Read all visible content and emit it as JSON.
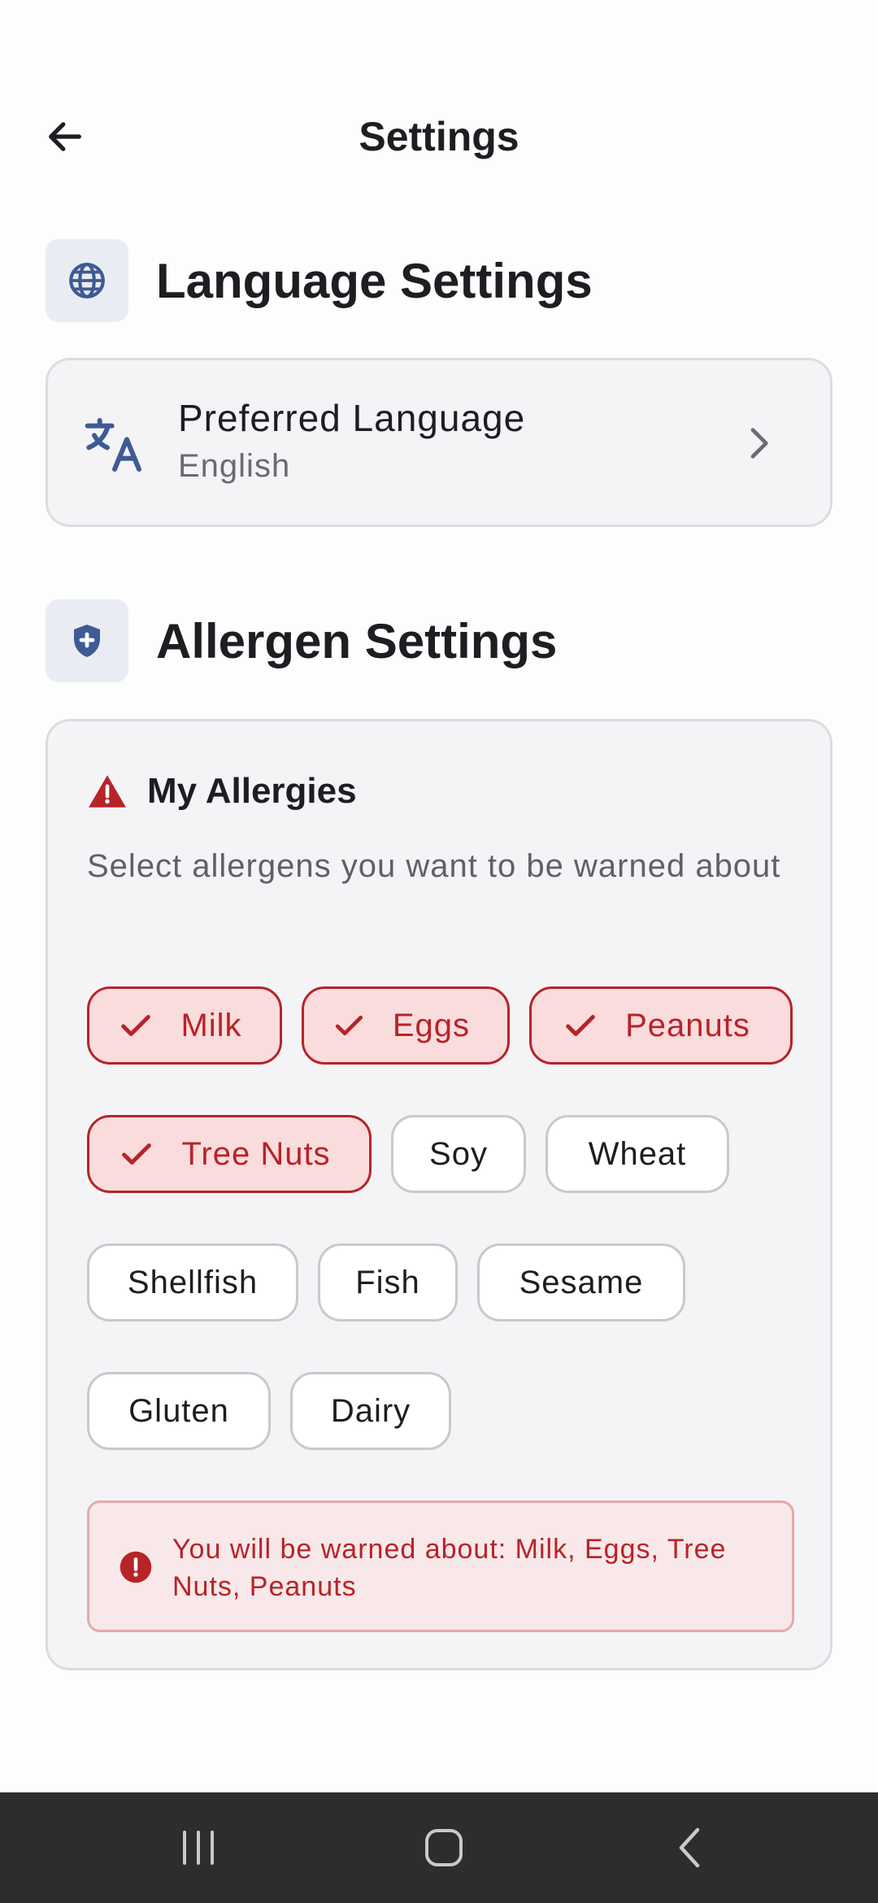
{
  "header": {
    "title": "Settings",
    "back_icon": "arrow-left-icon"
  },
  "language_section": {
    "title": "Language Settings",
    "icon": "globe-icon",
    "preferred_language": {
      "label": "Preferred Language",
      "value": "English",
      "icon": "translate-icon",
      "chevron": "chevron-right-icon"
    }
  },
  "allergen_section": {
    "title": "Allergen Settings",
    "icon": "shield-plus-icon",
    "card": {
      "title": "My Allergies",
      "title_icon": "warning-triangle-icon",
      "description": "Select allergens you want to be warned about",
      "chips": [
        {
          "label": "Milk",
          "selected": true
        },
        {
          "label": "Eggs",
          "selected": true
        },
        {
          "label": "Peanuts",
          "selected": true
        },
        {
          "label": "Tree Nuts",
          "selected": true
        },
        {
          "label": "Soy",
          "selected": false
        },
        {
          "label": "Wheat",
          "selected": false
        },
        {
          "label": "Shellfish",
          "selected": false
        },
        {
          "label": "Fish",
          "selected": false
        },
        {
          "label": "Sesame",
          "selected": false
        },
        {
          "label": "Gluten",
          "selected": false
        },
        {
          "label": "Dairy",
          "selected": false
        }
      ],
      "warning": {
        "icon": "info-circle-icon",
        "text": "You will be warned about: Milk, Eggs, Tree Nuts, Peanuts"
      }
    }
  },
  "nav_bar": {
    "recents_icon": "recents-icon",
    "home_icon": "home-icon",
    "back_icon": "back-chevron-icon"
  },
  "colors": {
    "accent_red": "#b72328",
    "selected_chip_bg": "#fbdcdd",
    "icon_blue": "#3e5b94",
    "nav_bg": "#2d2d2e"
  }
}
